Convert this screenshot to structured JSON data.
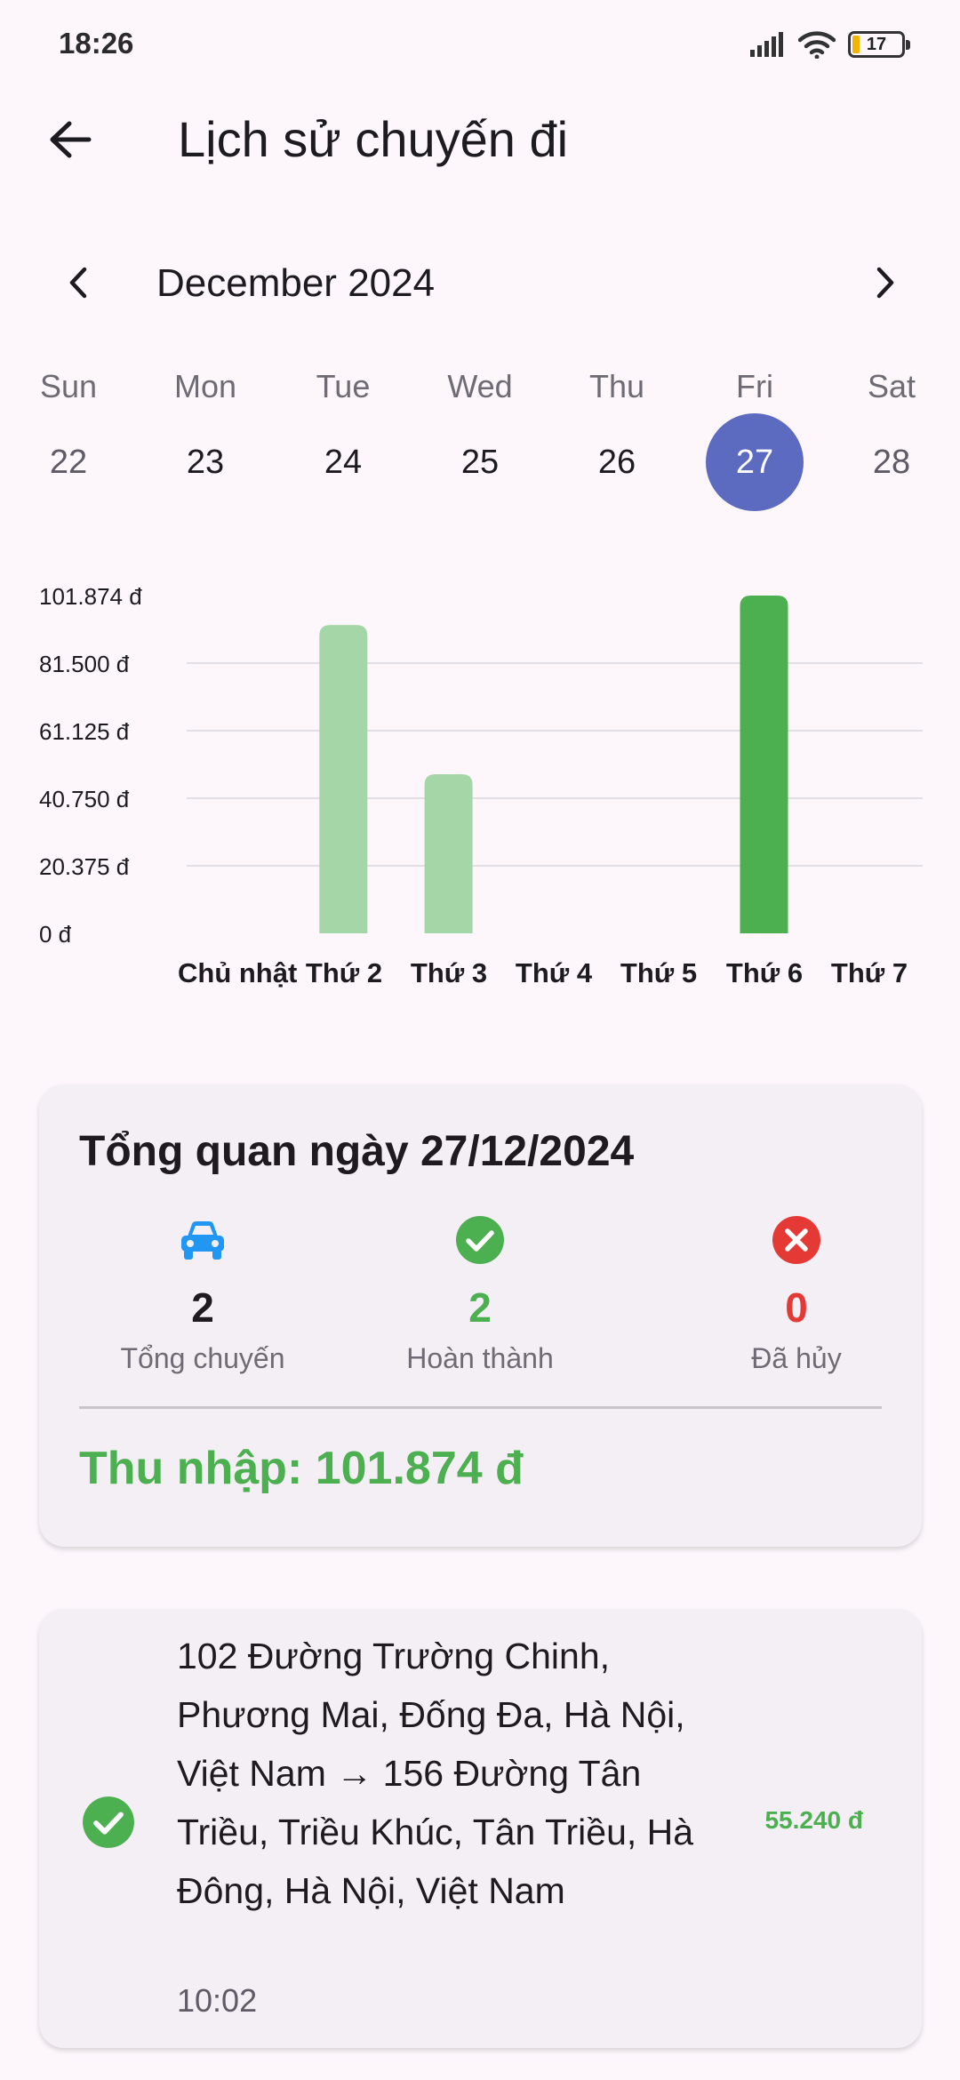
{
  "status_bar": {
    "time": "18:26",
    "battery": "17"
  },
  "app_bar": {
    "title": "Lịch sử chuyến đi"
  },
  "calendar": {
    "month_label": "December 2024",
    "days": [
      {
        "name": "Sun",
        "num": "22",
        "weekend": true,
        "selected": false
      },
      {
        "name": "Mon",
        "num": "23",
        "weekend": false,
        "selected": false
      },
      {
        "name": "Tue",
        "num": "24",
        "weekend": false,
        "selected": false
      },
      {
        "name": "Wed",
        "num": "25",
        "weekend": false,
        "selected": false
      },
      {
        "name": "Thu",
        "num": "26",
        "weekend": false,
        "selected": false
      },
      {
        "name": "Fri",
        "num": "27",
        "weekend": false,
        "selected": true
      },
      {
        "name": "Sat",
        "num": "28",
        "weekend": true,
        "selected": false
      }
    ],
    "selected_color": "#5c6bc0"
  },
  "chart_data": {
    "type": "bar",
    "categories": [
      "Chủ nhật",
      "Thứ 2",
      "Thứ 3",
      "Thứ 4",
      "Thứ 5",
      "Thứ 6",
      "Thứ 7"
    ],
    "values": [
      0,
      93000,
      48000,
      0,
      0,
      101874,
      0
    ],
    "highlight_index": 5,
    "y_ticks": [
      "0 đ",
      "20.375 đ",
      "40.750 đ",
      "61.125 đ",
      "81.500 đ",
      "101.874 đ"
    ],
    "y_tick_values": [
      0,
      20375,
      40750,
      61125,
      81500,
      101874
    ],
    "ylim": [
      0,
      101874
    ],
    "grid": true,
    "bar_color": "#4caf50",
    "bar_color_muted": "#a5d6a7",
    "title": "",
    "xlabel": "",
    "ylabel": ""
  },
  "summary": {
    "title": "Tổng quan ngày 27/12/2024",
    "total": {
      "value": "2",
      "label": "Tổng chuyến",
      "icon": "car-icon",
      "color": "#2196f3"
    },
    "completed": {
      "value": "2",
      "label": "Hoàn thành",
      "icon": "check-circle-icon",
      "color": "#4caf50"
    },
    "cancelled": {
      "value": "0",
      "label": "Đã hủy",
      "icon": "cancel-circle-icon",
      "color": "#e53935"
    },
    "income": "Thu nhập: 101.874 đ"
  },
  "trips": [
    {
      "route": "102 Đường Trường Chinh, Phương Mai, Đống Đa, Hà Nội, Việt Nam → 156 Đường Tân Triều, Triều Khúc, Tân Triều, Hà Đông, Hà Nội, Việt Nam",
      "time": "10:02",
      "price": "55.240 đ",
      "status_icon": "check-circle-icon"
    }
  ]
}
